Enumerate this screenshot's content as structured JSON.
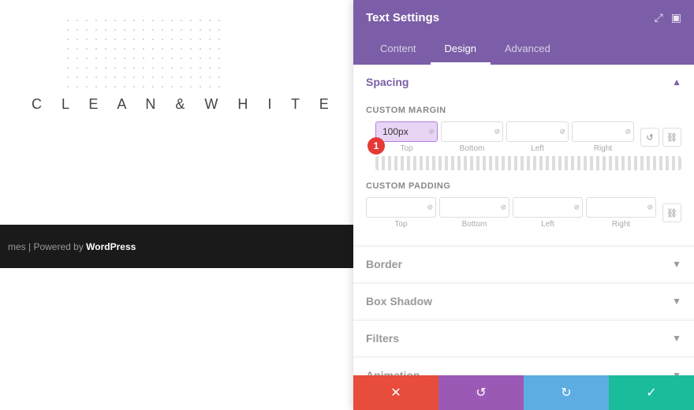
{
  "page": {
    "bg_text": "C L E A N  &  W H I T E",
    "powered_by_prefix": "mes | Powered by ",
    "powered_by_brand": "WordPress"
  },
  "panel": {
    "title": "Text Settings",
    "icons": [
      "⤢",
      "▣"
    ],
    "tabs": [
      {
        "label": "Content",
        "active": false
      },
      {
        "label": "Design",
        "active": true
      },
      {
        "label": "Advanced",
        "active": false
      }
    ]
  },
  "spacing": {
    "section_title": "Spacing",
    "custom_margin_label": "Custom Margin",
    "custom_padding_label": "Custom Padding",
    "margin_fields": [
      {
        "value": "100px",
        "unit": "⊘",
        "col": "Top",
        "highlighted": true
      },
      {
        "value": "",
        "unit": "⊘",
        "col": "Bottom",
        "highlighted": false
      },
      {
        "value": "",
        "unit": "⊘",
        "col": "Left",
        "highlighted": false
      },
      {
        "value": "",
        "unit": "⊘",
        "col": "Right",
        "highlighted": false
      }
    ],
    "padding_fields": [
      {
        "value": "",
        "unit": "⊘",
        "col": "Top",
        "highlighted": false
      },
      {
        "value": "",
        "unit": "⊘",
        "col": "Bottom",
        "highlighted": false
      },
      {
        "value": "",
        "unit": "⊘",
        "col": "Left",
        "highlighted": false
      },
      {
        "value": "",
        "unit": "⊘",
        "col": "Right",
        "highlighted": false
      }
    ]
  },
  "sections": [
    {
      "title": "Border"
    },
    {
      "title": "Box Shadow"
    },
    {
      "title": "Filters"
    },
    {
      "title": "Animation"
    }
  ],
  "footer": {
    "cancel_icon": "✕",
    "undo_icon": "↺",
    "redo_icon": "↻",
    "save_icon": "✓"
  }
}
